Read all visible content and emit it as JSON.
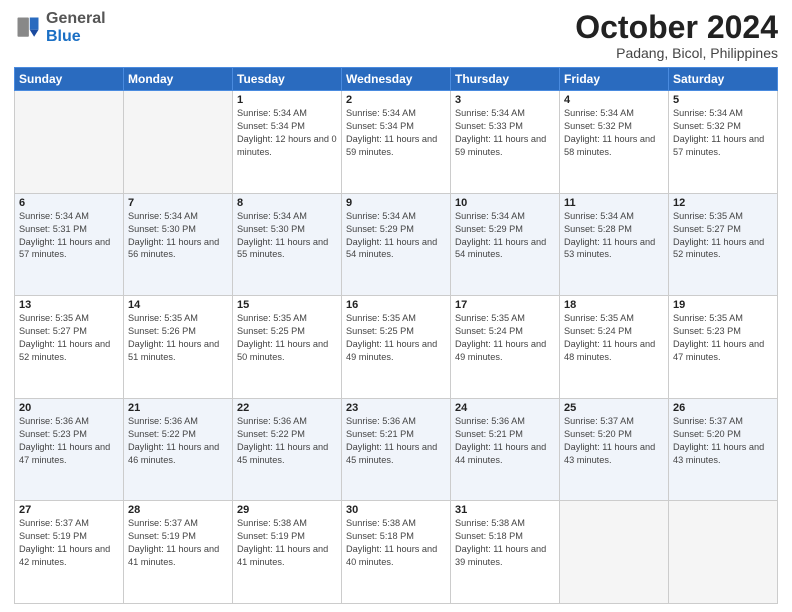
{
  "header": {
    "logo_general": "General",
    "logo_blue": "Blue",
    "month": "October 2024",
    "location": "Padang, Bicol, Philippines"
  },
  "days_of_week": [
    "Sunday",
    "Monday",
    "Tuesday",
    "Wednesday",
    "Thursday",
    "Friday",
    "Saturday"
  ],
  "weeks": [
    [
      {
        "day": "",
        "empty": true
      },
      {
        "day": "",
        "empty": true
      },
      {
        "day": "1",
        "sunrise": "Sunrise: 5:34 AM",
        "sunset": "Sunset: 5:34 PM",
        "daylight": "Daylight: 12 hours and 0 minutes."
      },
      {
        "day": "2",
        "sunrise": "Sunrise: 5:34 AM",
        "sunset": "Sunset: 5:34 PM",
        "daylight": "Daylight: 11 hours and 59 minutes."
      },
      {
        "day": "3",
        "sunrise": "Sunrise: 5:34 AM",
        "sunset": "Sunset: 5:33 PM",
        "daylight": "Daylight: 11 hours and 59 minutes."
      },
      {
        "day": "4",
        "sunrise": "Sunrise: 5:34 AM",
        "sunset": "Sunset: 5:32 PM",
        "daylight": "Daylight: 11 hours and 58 minutes."
      },
      {
        "day": "5",
        "sunrise": "Sunrise: 5:34 AM",
        "sunset": "Sunset: 5:32 PM",
        "daylight": "Daylight: 11 hours and 57 minutes."
      }
    ],
    [
      {
        "day": "6",
        "sunrise": "Sunrise: 5:34 AM",
        "sunset": "Sunset: 5:31 PM",
        "daylight": "Daylight: 11 hours and 57 minutes."
      },
      {
        "day": "7",
        "sunrise": "Sunrise: 5:34 AM",
        "sunset": "Sunset: 5:30 PM",
        "daylight": "Daylight: 11 hours and 56 minutes."
      },
      {
        "day": "8",
        "sunrise": "Sunrise: 5:34 AM",
        "sunset": "Sunset: 5:30 PM",
        "daylight": "Daylight: 11 hours and 55 minutes."
      },
      {
        "day": "9",
        "sunrise": "Sunrise: 5:34 AM",
        "sunset": "Sunset: 5:29 PM",
        "daylight": "Daylight: 11 hours and 54 minutes."
      },
      {
        "day": "10",
        "sunrise": "Sunrise: 5:34 AM",
        "sunset": "Sunset: 5:29 PM",
        "daylight": "Daylight: 11 hours and 54 minutes."
      },
      {
        "day": "11",
        "sunrise": "Sunrise: 5:34 AM",
        "sunset": "Sunset: 5:28 PM",
        "daylight": "Daylight: 11 hours and 53 minutes."
      },
      {
        "day": "12",
        "sunrise": "Sunrise: 5:35 AM",
        "sunset": "Sunset: 5:27 PM",
        "daylight": "Daylight: 11 hours and 52 minutes."
      }
    ],
    [
      {
        "day": "13",
        "sunrise": "Sunrise: 5:35 AM",
        "sunset": "Sunset: 5:27 PM",
        "daylight": "Daylight: 11 hours and 52 minutes."
      },
      {
        "day": "14",
        "sunrise": "Sunrise: 5:35 AM",
        "sunset": "Sunset: 5:26 PM",
        "daylight": "Daylight: 11 hours and 51 minutes."
      },
      {
        "day": "15",
        "sunrise": "Sunrise: 5:35 AM",
        "sunset": "Sunset: 5:25 PM",
        "daylight": "Daylight: 11 hours and 50 minutes."
      },
      {
        "day": "16",
        "sunrise": "Sunrise: 5:35 AM",
        "sunset": "Sunset: 5:25 PM",
        "daylight": "Daylight: 11 hours and 49 minutes."
      },
      {
        "day": "17",
        "sunrise": "Sunrise: 5:35 AM",
        "sunset": "Sunset: 5:24 PM",
        "daylight": "Daylight: 11 hours and 49 minutes."
      },
      {
        "day": "18",
        "sunrise": "Sunrise: 5:35 AM",
        "sunset": "Sunset: 5:24 PM",
        "daylight": "Daylight: 11 hours and 48 minutes."
      },
      {
        "day": "19",
        "sunrise": "Sunrise: 5:35 AM",
        "sunset": "Sunset: 5:23 PM",
        "daylight": "Daylight: 11 hours and 47 minutes."
      }
    ],
    [
      {
        "day": "20",
        "sunrise": "Sunrise: 5:36 AM",
        "sunset": "Sunset: 5:23 PM",
        "daylight": "Daylight: 11 hours and 47 minutes."
      },
      {
        "day": "21",
        "sunrise": "Sunrise: 5:36 AM",
        "sunset": "Sunset: 5:22 PM",
        "daylight": "Daylight: 11 hours and 46 minutes."
      },
      {
        "day": "22",
        "sunrise": "Sunrise: 5:36 AM",
        "sunset": "Sunset: 5:22 PM",
        "daylight": "Daylight: 11 hours and 45 minutes."
      },
      {
        "day": "23",
        "sunrise": "Sunrise: 5:36 AM",
        "sunset": "Sunset: 5:21 PM",
        "daylight": "Daylight: 11 hours and 45 minutes."
      },
      {
        "day": "24",
        "sunrise": "Sunrise: 5:36 AM",
        "sunset": "Sunset: 5:21 PM",
        "daylight": "Daylight: 11 hours and 44 minutes."
      },
      {
        "day": "25",
        "sunrise": "Sunrise: 5:37 AM",
        "sunset": "Sunset: 5:20 PM",
        "daylight": "Daylight: 11 hours and 43 minutes."
      },
      {
        "day": "26",
        "sunrise": "Sunrise: 5:37 AM",
        "sunset": "Sunset: 5:20 PM",
        "daylight": "Daylight: 11 hours and 43 minutes."
      }
    ],
    [
      {
        "day": "27",
        "sunrise": "Sunrise: 5:37 AM",
        "sunset": "Sunset: 5:19 PM",
        "daylight": "Daylight: 11 hours and 42 minutes."
      },
      {
        "day": "28",
        "sunrise": "Sunrise: 5:37 AM",
        "sunset": "Sunset: 5:19 PM",
        "daylight": "Daylight: 11 hours and 41 minutes."
      },
      {
        "day": "29",
        "sunrise": "Sunrise: 5:38 AM",
        "sunset": "Sunset: 5:19 PM",
        "daylight": "Daylight: 11 hours and 41 minutes."
      },
      {
        "day": "30",
        "sunrise": "Sunrise: 5:38 AM",
        "sunset": "Sunset: 5:18 PM",
        "daylight": "Daylight: 11 hours and 40 minutes."
      },
      {
        "day": "31",
        "sunrise": "Sunrise: 5:38 AM",
        "sunset": "Sunset: 5:18 PM",
        "daylight": "Daylight: 11 hours and 39 minutes."
      },
      {
        "day": "",
        "empty": true
      },
      {
        "day": "",
        "empty": true
      }
    ]
  ]
}
